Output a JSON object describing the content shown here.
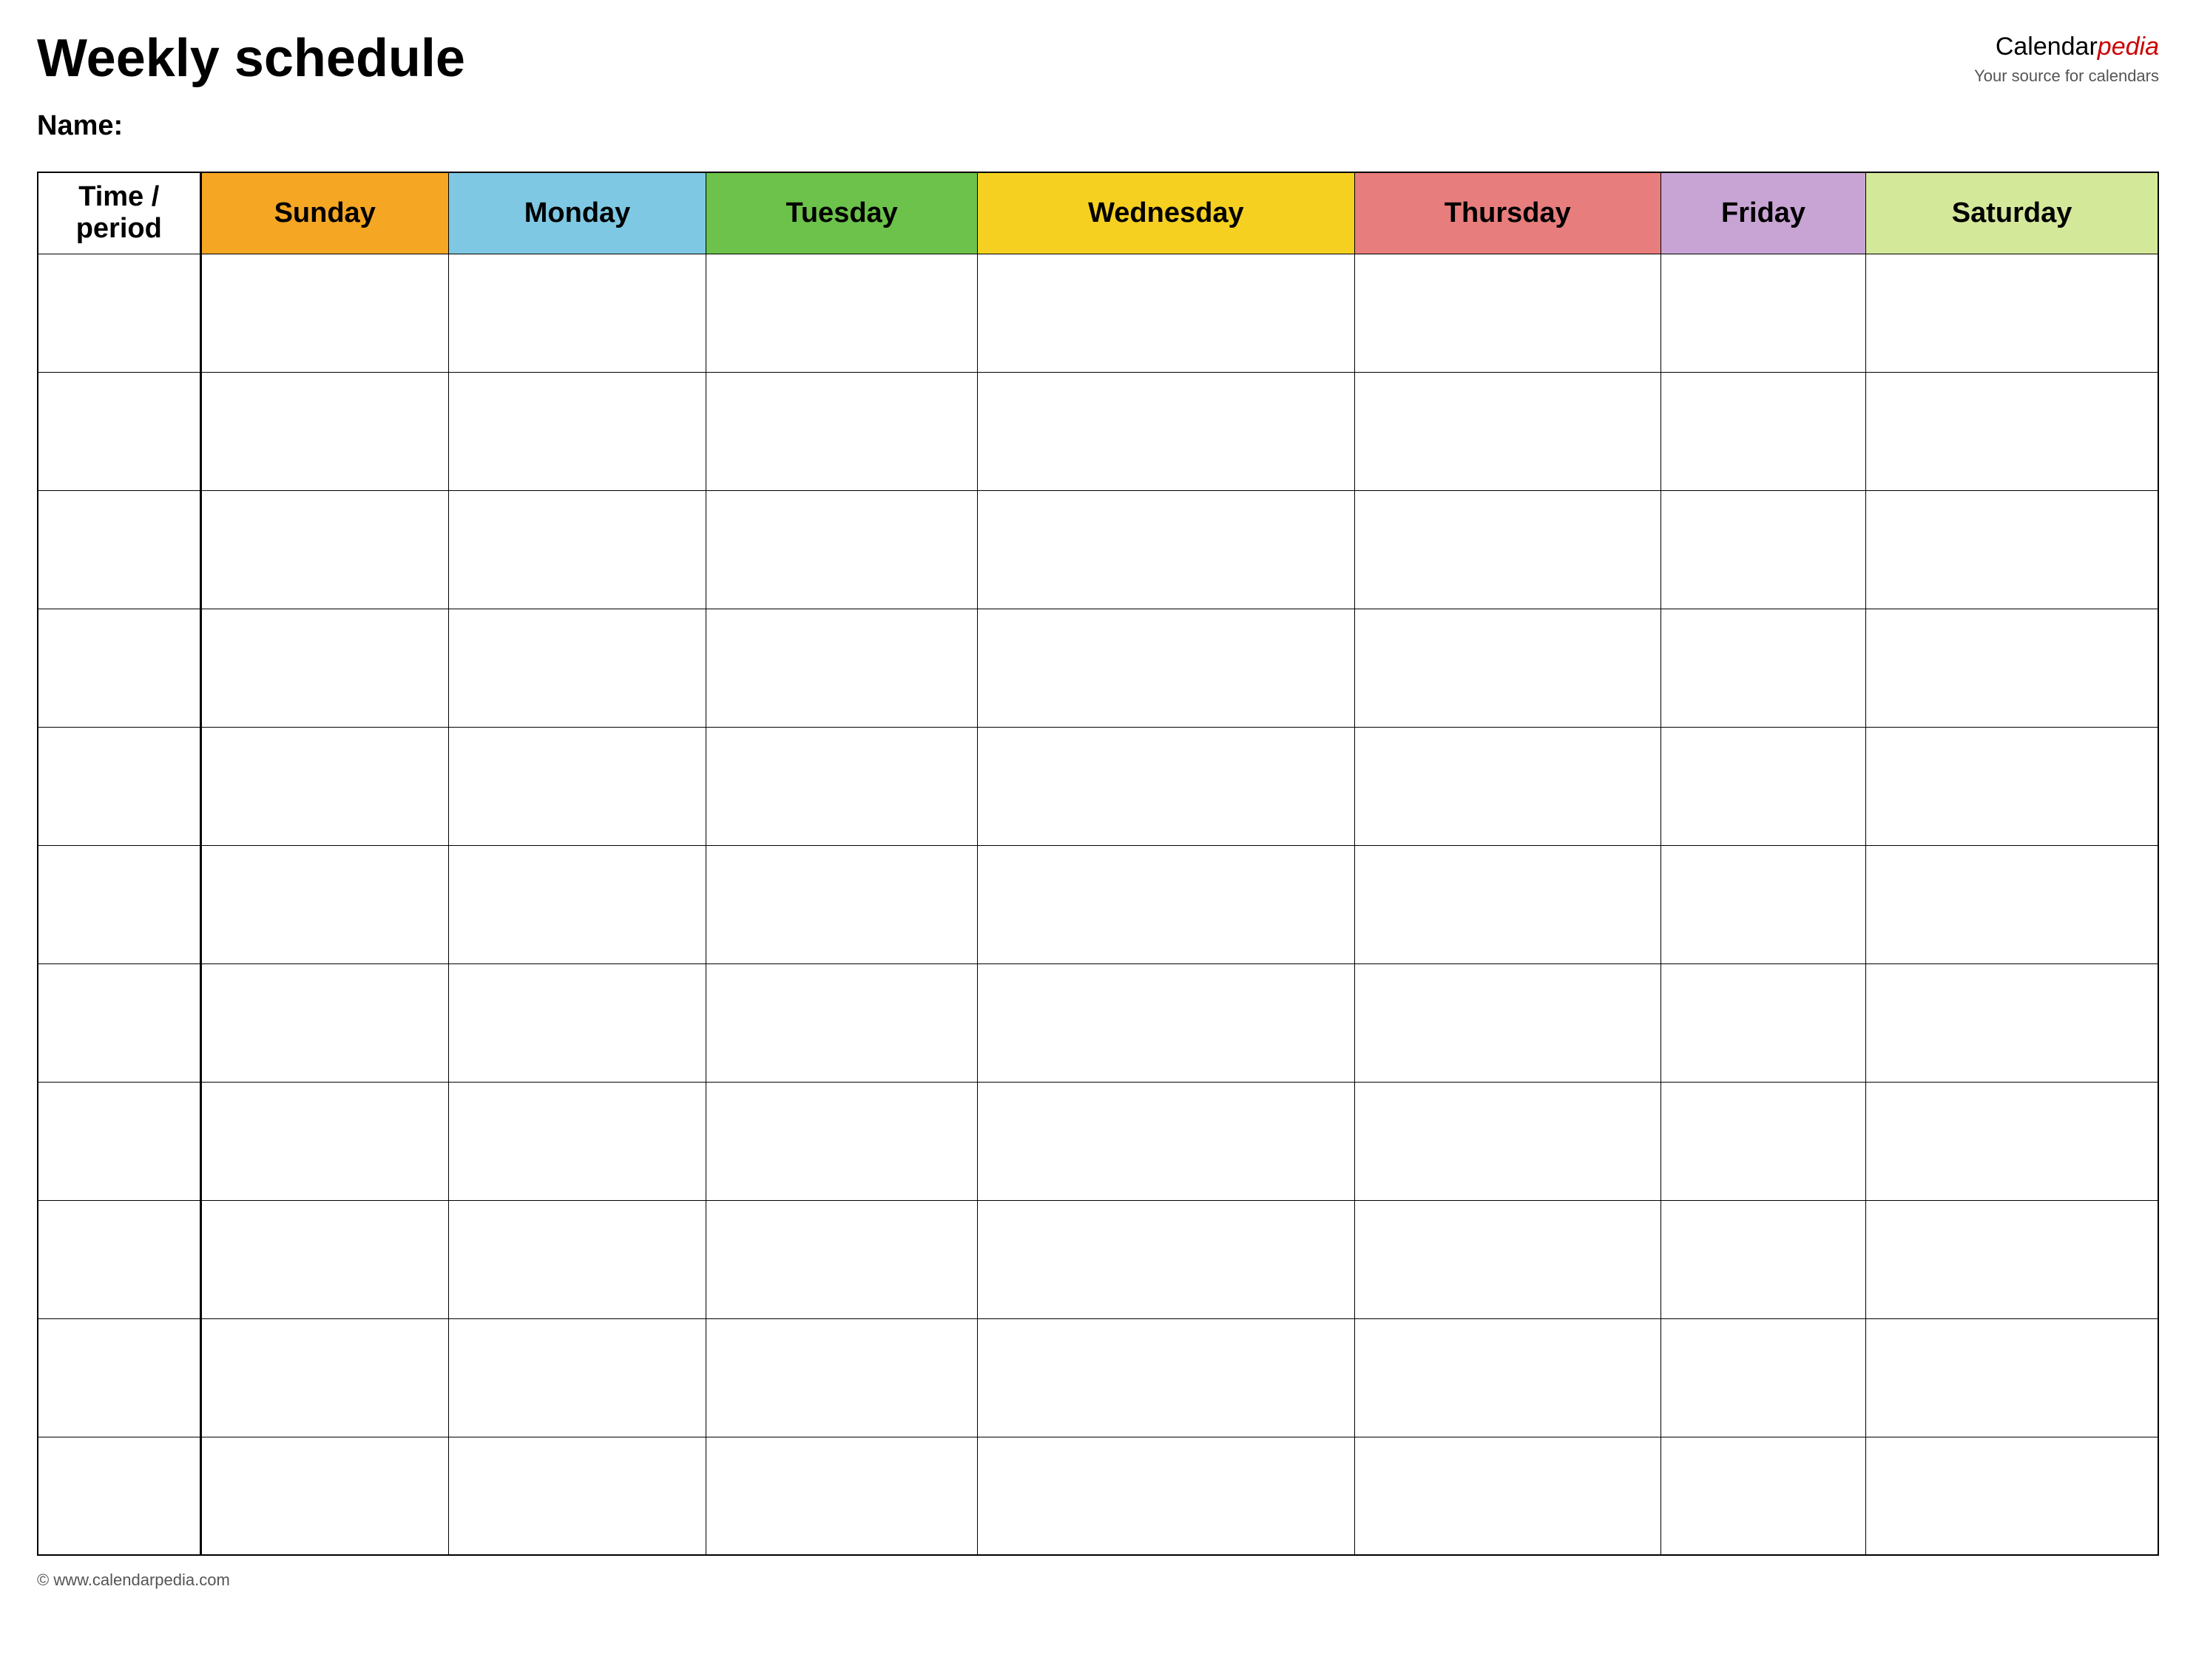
{
  "header": {
    "title": "Weekly schedule",
    "name_label": "Name:",
    "logo": {
      "calendar_text": "Calendar",
      "pedia_text": "pedia",
      "subtitle": "Your source for calendars"
    }
  },
  "table": {
    "time_period_label": "Time / period",
    "days": [
      {
        "label": "Sunday",
        "color": "#f5a623",
        "class": "sunday-header"
      },
      {
        "label": "Monday",
        "color": "#7ec8e3",
        "class": "monday-header"
      },
      {
        "label": "Tuesday",
        "color": "#6cc24a",
        "class": "tuesday-header"
      },
      {
        "label": "Wednesday",
        "color": "#f5d020",
        "class": "wednesday-header"
      },
      {
        "label": "Thursday",
        "color": "#e87d7d",
        "class": "thursday-header"
      },
      {
        "label": "Friday",
        "color": "#c8a4d4",
        "class": "friday-header"
      },
      {
        "label": "Saturday",
        "color": "#d4e89a",
        "class": "saturday-header"
      }
    ],
    "row_count": 11
  },
  "footer": {
    "url": "www.calendarpedia.com"
  }
}
